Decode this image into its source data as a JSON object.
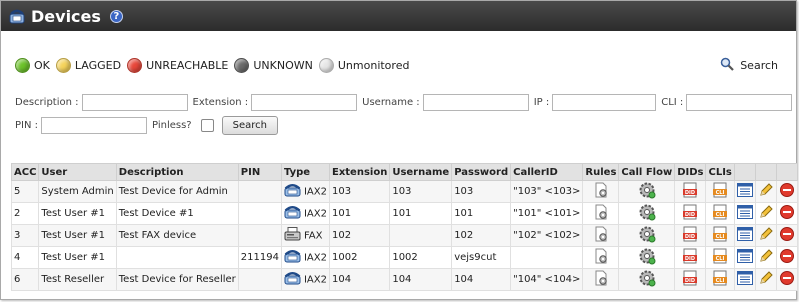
{
  "header": {
    "title": "Devices",
    "help_glyph": "?"
  },
  "legend": [
    {
      "label": "OK",
      "color": "#6cc22a"
    },
    {
      "label": "LAGGED",
      "color": "#f5d35b"
    },
    {
      "label": "UNREACHABLE",
      "color": "#e8473a"
    },
    {
      "label": "UNKNOWN",
      "color": "#6a6a6a"
    },
    {
      "label": "Unmonitored",
      "color": "#e6e6e6"
    }
  ],
  "search_link": {
    "label": "Search"
  },
  "filters": {
    "description": "Description :",
    "extension": "Extension :",
    "username": "Username :",
    "ip": "IP :",
    "cli": "CLI :",
    "pin": "PIN :",
    "pinless": "Pinless?",
    "search_button": "Search"
  },
  "table": {
    "columns": [
      "ACC",
      "User",
      "Description",
      "PIN",
      "Type",
      "Extension",
      "Username",
      "Password",
      "CallerID",
      "Rules",
      "Call Flow",
      "DIDs",
      "CLIs",
      "",
      "",
      ""
    ],
    "rows": [
      {
        "acc": "5",
        "user": "System Admin",
        "description": "Test Device for Admin",
        "pin": "",
        "type_icon": "phone-icon",
        "type": "IAX2",
        "extension": "103",
        "username": "103",
        "password": "103",
        "callerid": "\"103\" <103>"
      },
      {
        "acc": "2",
        "user": "Test User #1",
        "description": "Test Device #1",
        "pin": "",
        "type_icon": "phone-icon",
        "type": "IAX2",
        "extension": "101",
        "username": "101",
        "password": "101",
        "callerid": "\"101\" <101>"
      },
      {
        "acc": "3",
        "user": "Test User #1",
        "description": "Test FAX device",
        "pin": "",
        "type_icon": "fax-icon",
        "type": "FAX",
        "extension": "102",
        "username": "",
        "password": "102",
        "callerid": "\"102\" <102>"
      },
      {
        "acc": "4",
        "user": "Test User #1",
        "description": "",
        "pin": "211194",
        "type_icon": "phone-icon",
        "type": "IAX2",
        "extension": "1002",
        "username": "1002",
        "password": "vejs9cut",
        "callerid": ""
      },
      {
        "acc": "6",
        "user": "Test Reseller",
        "description": "Test Device for Reseller",
        "pin": "",
        "type_icon": "phone-icon",
        "type": "IAX2",
        "extension": "104",
        "username": "104",
        "password": "104",
        "callerid": "\"104\" <104>"
      }
    ]
  }
}
